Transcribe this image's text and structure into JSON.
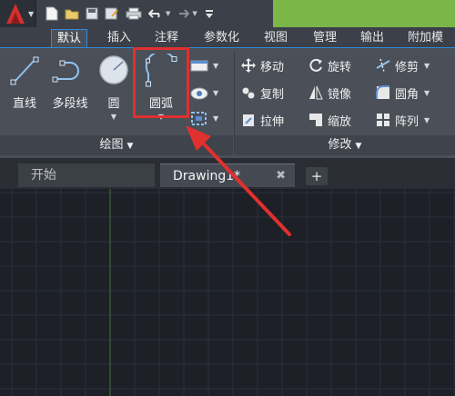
{
  "quick_access": {
    "icons": [
      "app-logo-icon",
      "new-file-icon",
      "open-folder-icon",
      "save-icon",
      "save-as-icon",
      "print-icon",
      "undo-icon",
      "redo-icon",
      "customize-icon"
    ]
  },
  "ribbon_tabs": [
    {
      "label": "默认",
      "active": true
    },
    {
      "label": "插入"
    },
    {
      "label": "注释"
    },
    {
      "label": "参数化"
    },
    {
      "label": "视图"
    },
    {
      "label": "管理"
    },
    {
      "label": "输出"
    },
    {
      "label": "附加模块"
    }
  ],
  "draw_panel": {
    "title": "绘图",
    "buttons": [
      {
        "label": "直线",
        "icon": "line-icon"
      },
      {
        "label": "多段线",
        "icon": "polyline-icon"
      },
      {
        "label": "圆",
        "icon": "circle-icon"
      },
      {
        "label": "圆弧",
        "icon": "arc-icon"
      }
    ],
    "small_icons": [
      "rectangle-icon",
      "hatch-icon",
      "region-icon"
    ]
  },
  "modify_panel": {
    "title": "修改",
    "items": [
      {
        "label": "移动",
        "icon": "move-icon"
      },
      {
        "label": "旋转",
        "icon": "rotate-icon"
      },
      {
        "label": "修剪",
        "icon": "trim-icon"
      },
      {
        "label": "复制",
        "icon": "copy-icon"
      },
      {
        "label": "镜像",
        "icon": "mirror-icon"
      },
      {
        "label": "圆角",
        "icon": "fillet-icon"
      },
      {
        "label": "拉伸",
        "icon": "stretch-icon"
      },
      {
        "label": "缩放",
        "icon": "scale-icon"
      },
      {
        "label": "阵列",
        "icon": "array-icon"
      }
    ]
  },
  "doc_tabs": [
    {
      "label": "开始"
    },
    {
      "label": "Drawing1*",
      "active": true
    }
  ],
  "colors": {
    "accent_blue": "#2f8de0",
    "highlight_red": "#e0302f",
    "titlebar_green": "#7ab648",
    "canvas": "#1d2027"
  }
}
